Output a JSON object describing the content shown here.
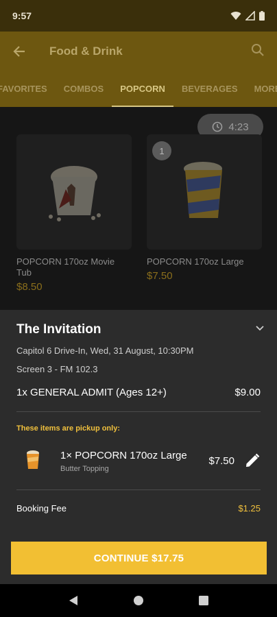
{
  "status_bar": {
    "time": "9:57"
  },
  "app_bar": {
    "title": "Food & Drink"
  },
  "tabs": [
    {
      "label": "FAVORITES"
    },
    {
      "label": "COMBOS"
    },
    {
      "label": "POPCORN"
    },
    {
      "label": "BEVERAGES"
    },
    {
      "label": "MORE I"
    }
  ],
  "timer": {
    "value": "4:23"
  },
  "products": [
    {
      "name": "POPCORN 170oz Movie Tub",
      "price": "$8.50"
    },
    {
      "name": "POPCORN 170oz Large",
      "price": "$7.50",
      "badge": "1"
    }
  ],
  "order": {
    "title": "The Invitation",
    "venue_line": "Capitol 6 Drive-In, Wed, 31 August, 10:30PM",
    "screen_line": "Screen 3 - FM 102.3",
    "ticket": {
      "label": "1x GENERAL ADMIT (Ages 12+)",
      "price": "$9.00"
    },
    "pickup_note": "These items are pickup only:",
    "item": {
      "name": "1× POPCORN 170oz Large",
      "modifier": "Butter Topping",
      "price": "$7.50"
    },
    "fee": {
      "label": "Booking Fee",
      "value": "$1.25"
    },
    "continue_label": "CONTINUE $17.75"
  },
  "colors": {
    "accent": "#f2bf33",
    "sheet_bg": "#2c2c2c"
  }
}
